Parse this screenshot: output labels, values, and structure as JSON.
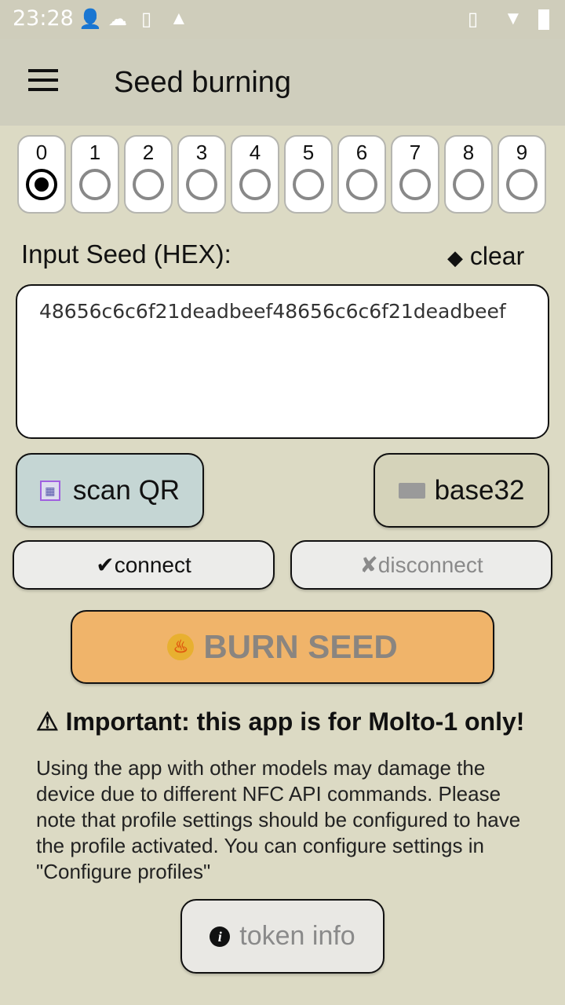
{
  "status_bar": {
    "time": "23:28",
    "icons": [
      "contact-card-icon",
      "cloud-icon",
      "download-icon",
      "warning-icon",
      "vibrate-icon",
      "wifi-icon",
      "battery-icon"
    ]
  },
  "app_bar": {
    "title": "Seed burning",
    "menu_icon": "hamburger-menu-icon"
  },
  "slots": {
    "selected": 0,
    "items": [
      "0",
      "1",
      "2",
      "3",
      "4",
      "5",
      "6",
      "7",
      "8",
      "9"
    ]
  },
  "seed": {
    "label": "Input Seed (HEX):",
    "clear_label": "clear",
    "value": "48656c6c6f21deadbeef48656c6c6f21deadbeef"
  },
  "buttons": {
    "scan_qr": "scan QR",
    "base32": "base32",
    "connect": "connect",
    "disconnect": "disconnect",
    "burn": "BURN SEED",
    "token_info": "token info"
  },
  "notice": {
    "title": "⚠ Important: this app is for Molto-1 only!",
    "body": "Using the app with other models may damage the device due to different NFC API commands. Please note that profile settings should be configured to have the profile activated. You can configure settings in \"Configure profiles\""
  }
}
